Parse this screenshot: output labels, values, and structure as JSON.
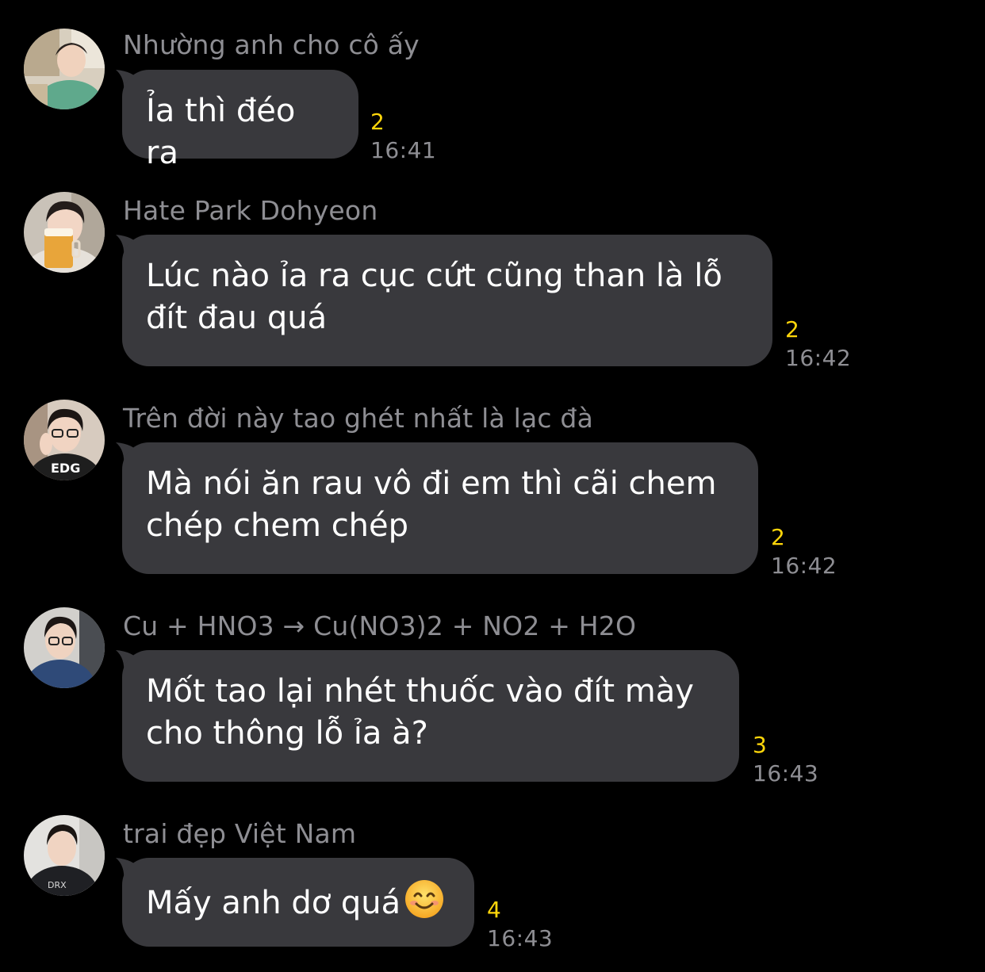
{
  "messages": [
    {
      "sender": "Nhường anh cho cô ấy",
      "text": "Ỉa thì đéo ra",
      "count": "2",
      "time": "16:41",
      "avatar": "avatar-boy-green-shirt"
    },
    {
      "sender": "Hate Park Dohyeon",
      "text": "Lúc nào ỉa ra cục cứt cũng than là lỗ đít đau quá",
      "count": "2",
      "time": "16:42",
      "avatar": "avatar-boy-beer-glass"
    },
    {
      "sender": "Trên đời này tao ghét nhất là lạc đà",
      "text": "Mà nói ăn rau vô đi em thì cãi chem chép chem chép",
      "count": "2",
      "time": "16:42",
      "avatar": "avatar-boy-glasses-jersey"
    },
    {
      "sender": "Cu + HNO3 → Cu(NO3)2 + NO2 + H2O",
      "text": "Mốt tao lại nhét thuốc vào đít mày cho thông lỗ ỉa à?",
      "count": "3",
      "time": "16:43",
      "avatar": "avatar-boy-denim-jacket"
    },
    {
      "sender": "trai đẹp Việt Nam",
      "text": "Mấy anh dơ quá",
      "emoji": "smiling-face-emoji",
      "count": "4",
      "time": "16:43",
      "avatar": "avatar-boy-black-hoodie"
    }
  ],
  "colors": {
    "background": "#000000",
    "bubble": "#39393d",
    "sender": "#8e8e93",
    "time": "#8e8e93",
    "count": "#ffd60a",
    "text": "#ffffff"
  }
}
